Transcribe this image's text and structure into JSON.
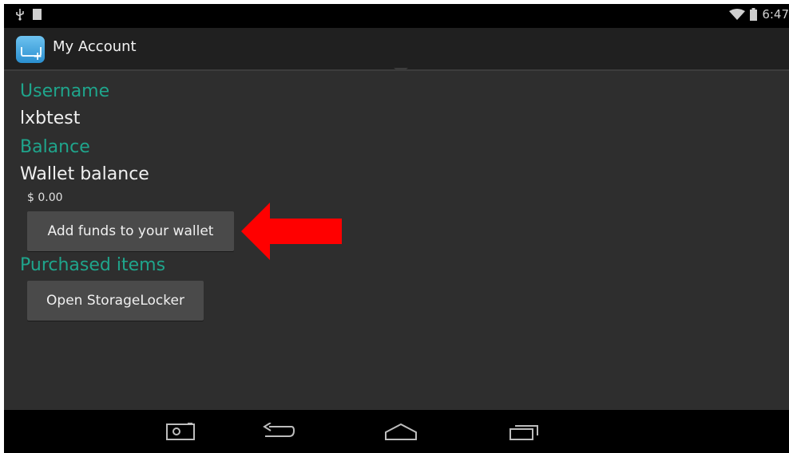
{
  "status_bar": {
    "time": "6:47",
    "usb_icon": "usb-icon",
    "battery_icon": "battery-icon",
    "wifi_icon": "wifi-icon"
  },
  "action_bar": {
    "title": "My Account",
    "app_icon": "app-launcher-icon"
  },
  "account": {
    "username_label": "Username",
    "username_value": "lxbtest",
    "balance_label": "Balance",
    "wallet_label": "Wallet balance",
    "wallet_amount": "$ 0.00",
    "add_funds_button": "Add funds to your wallet",
    "purchased_label": "Purchased items",
    "open_locker_button": "Open StorageLocker"
  },
  "annotation": {
    "arrow_color": "#ff0000"
  },
  "colors": {
    "section_header": "#1fa58c",
    "background": "#2e2e2e",
    "button": "#4a4a4a"
  },
  "nav_bar": {
    "items": [
      "screenshot-icon",
      "back-icon",
      "home-icon",
      "recent-apps-icon"
    ]
  }
}
